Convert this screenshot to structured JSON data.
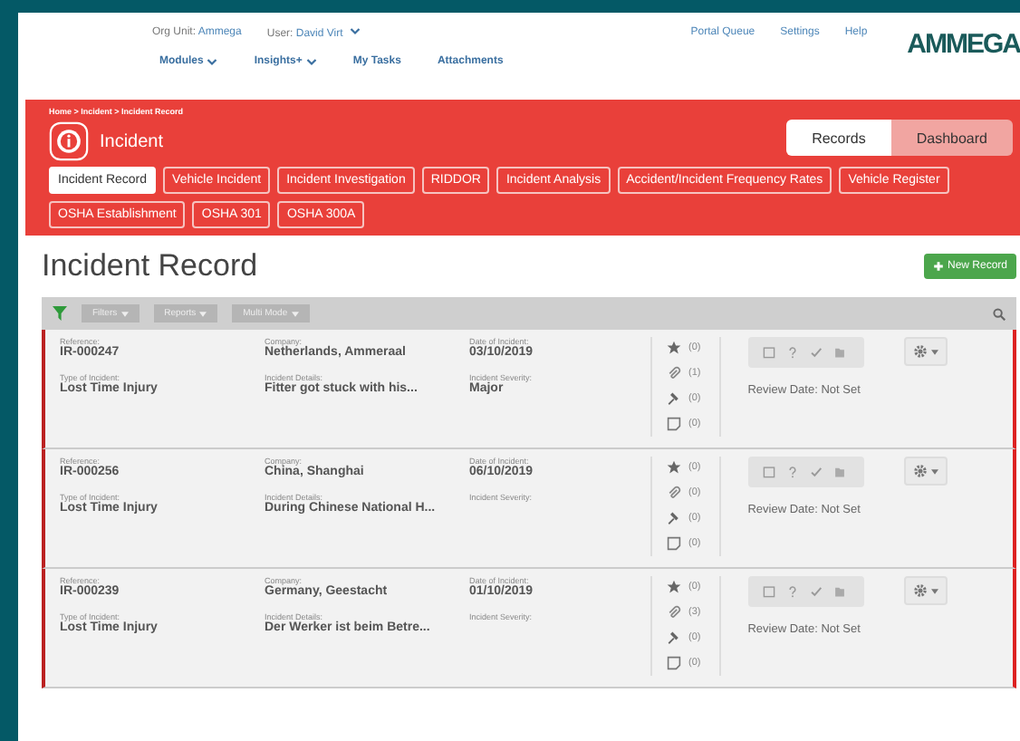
{
  "topbar": {
    "org_label": "Org Unit:",
    "org_value": "Ammega",
    "user_label": "User:",
    "user_value": "David Virt",
    "links": [
      "Portal Queue",
      "Settings",
      "Help"
    ],
    "logo": "AMMEGA"
  },
  "nav": [
    {
      "label": "Modules",
      "dropdown": true
    },
    {
      "label": "Insights+",
      "dropdown": true
    },
    {
      "label": "My Tasks",
      "dropdown": false
    },
    {
      "label": "Attachments",
      "dropdown": false
    }
  ],
  "breadcrumb": "Home > Incident > Incident Record",
  "module_title": "Incident",
  "view_toggle": [
    {
      "label": "Records",
      "selected": true
    },
    {
      "label": "Dashboard",
      "selected": false
    }
  ],
  "tabs": [
    {
      "label": "Incident Record",
      "selected": true
    },
    {
      "label": "Vehicle Incident",
      "selected": false
    },
    {
      "label": "Incident Investigation",
      "selected": false
    },
    {
      "label": "RIDDOR",
      "selected": false
    },
    {
      "label": "Incident Analysis",
      "selected": false
    },
    {
      "label": "Accident/Incident Frequency Rates",
      "selected": false
    },
    {
      "label": "Vehicle Register",
      "selected": false
    },
    {
      "label": "OSHA Establishment",
      "selected": false
    },
    {
      "label": "OSHA 301",
      "selected": false
    },
    {
      "label": "OSHA 300A",
      "selected": false
    }
  ],
  "page_title": "Incident Record",
  "new_button": "New Record",
  "filters": [
    "Filters",
    "Reports",
    "Multi Mode"
  ],
  "records": [
    {
      "fields": [
        {
          "label": "Reference:",
          "value": "IR-000247"
        },
        {
          "label": "Company:",
          "value": "Netherlands, Ammeraal"
        },
        {
          "label": "Date of Incident:",
          "value": "03/10/2019"
        },
        {
          "label": "Type of Incident:",
          "value": "Lost Time Injury"
        },
        {
          "label": "Incident Details:",
          "value": "Fitter got stuck with his..."
        },
        {
          "label": "Incident Severity:",
          "value": "Major"
        }
      ],
      "counts": [
        "(0)",
        "(1)",
        "(0)",
        "(0)"
      ],
      "review": "Review Date: Not Set"
    },
    {
      "fields": [
        {
          "label": "Reference:",
          "value": "IR-000256"
        },
        {
          "label": "Company:",
          "value": "China, Shanghai"
        },
        {
          "label": "Date of Incident:",
          "value": "06/10/2019"
        },
        {
          "label": "Type of Incident:",
          "value": "Lost Time Injury"
        },
        {
          "label": "Incident Details:",
          "value": "During Chinese National H..."
        },
        {
          "label": "Incident Severity:"
        }
      ],
      "counts": [
        "(0)",
        "(0)",
        "(0)",
        "(0)"
      ],
      "review": "Review Date: Not Set"
    },
    {
      "fields": [
        {
          "label": "Reference:",
          "value": "IR-000239"
        },
        {
          "label": "Company:",
          "value": "Germany, Geestacht"
        },
        {
          "label": "Date of Incident:",
          "value": "01/10/2019"
        },
        {
          "label": "Type of Incident:",
          "value": "Lost Time Injury"
        },
        {
          "label": "Incident Details:",
          "value": "Der Werker ist beim Betre..."
        },
        {
          "label": "Incident Severity:"
        }
      ],
      "counts": [
        "(0)",
        "(3)",
        "(0)",
        "(0)"
      ],
      "review": "Review Date: Not Set"
    }
  ]
}
